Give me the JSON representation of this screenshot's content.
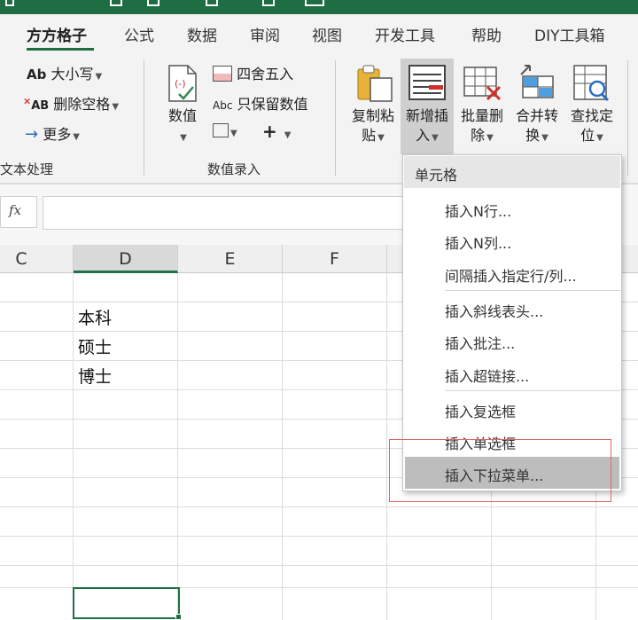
{
  "tabs": [
    "方方格子",
    "公式",
    "数据",
    "审阅",
    "视图",
    "开发工具",
    "帮助",
    "DIY工具箱"
  ],
  "active_tab": "方方格子",
  "ribbon": {
    "text_group": {
      "case_label": "大小写",
      "case_icon_text": "Ab",
      "remove_spaces_label": "删除空格",
      "remove_spaces_icon_text": "AB",
      "more_label": "更多",
      "group_label": "文本处理"
    },
    "number_group": {
      "value_label": "数值",
      "round_label": "四舍五入",
      "keep_value_label": "只保留数值",
      "keep_value_icon_text": "Abc",
      "group_label": "数值录入"
    },
    "big_buttons": [
      {
        "line1": "复制粘",
        "line2": "贴"
      },
      {
        "line1": "新增插",
        "line2": "入"
      },
      {
        "line1": "批量删",
        "line2": "除"
      },
      {
        "line1": "合并转",
        "line2": "换"
      },
      {
        "line1": "查找定",
        "line2": "位"
      }
    ]
  },
  "formula_bar": {
    "fx_label": "fx",
    "value": ""
  },
  "columns": [
    "C",
    "D",
    "E",
    "F"
  ],
  "selected_column": "D",
  "cells": {
    "D3": "本科",
    "D4": "硕士",
    "D5": "博士"
  },
  "dropdown": {
    "header": "单元格",
    "items": [
      "插入N行...",
      "插入N列...",
      "间隔插入指定行/列...",
      "插入斜线表头...",
      "插入批注...",
      "插入超链接...",
      "插入复选框",
      "插入单选框",
      "插入下拉菜单..."
    ],
    "highlighted_item": "插入下拉菜单..."
  },
  "colors": {
    "accent": "#1f6e43",
    "highlight_box": "#e06666",
    "menu_hover": "#bdbdbd"
  }
}
